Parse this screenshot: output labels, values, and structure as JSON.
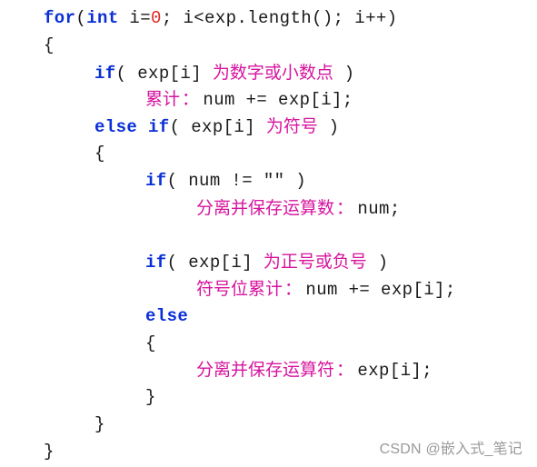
{
  "code": {
    "colors": {
      "keyword": "#0a2fd6",
      "number_literal": "#e0281e",
      "chinese_annotation": "#d6149e",
      "plain": "#1a1a1a",
      "watermark": "#9a9a9a"
    },
    "lines": [
      {
        "kw1": "for",
        "t1": "(",
        "kw2": "int",
        "t2": " i=",
        "num": "0",
        "t3": "; i<exp.length(); i++)"
      },
      {
        "t1": "{"
      },
      {
        "kw1": "if",
        "t1": "( exp[i] ",
        "cn": "为数字或小数点",
        "t2": " )"
      },
      {
        "cn": "累计",
        "colon": "：",
        "t1": "num += exp[i];"
      },
      {
        "kw1": "else if",
        "t1": "( exp[i] ",
        "cn": "为符号",
        "t2": " )"
      },
      {
        "t1": "{"
      },
      {
        "kw1": "if",
        "t1": "( num != \"\" )"
      },
      {
        "cn": "分离并保存运算数",
        "colon": "：",
        "t1": "num;"
      },
      {
        "t1": ""
      },
      {
        "kw1": "if",
        "t1": "( exp[i] ",
        "cn": "为正号或负号",
        "t2": " )"
      },
      {
        "cn": "符号位累计",
        "colon": "：",
        "t1": "num += exp[i];"
      },
      {
        "kw1": "else"
      },
      {
        "t1": "{"
      },
      {
        "cn": "分离并保存运算符",
        "colon": "：",
        "t1": "exp[i];"
      },
      {
        "t1": "}"
      },
      {
        "t1": "}"
      },
      {
        "t1": "}"
      }
    ]
  },
  "watermark": {
    "text": "CSDN @嵌入式_笔记"
  }
}
